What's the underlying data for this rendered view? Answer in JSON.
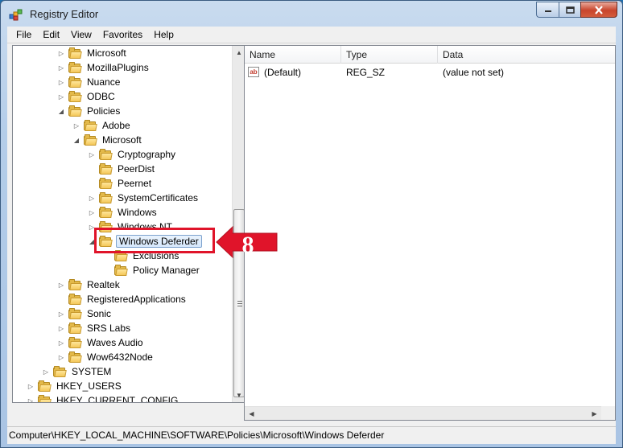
{
  "window": {
    "title": "Registry Editor",
    "controls": {
      "minimize": "minimize",
      "maximize": "maximize",
      "close": "close"
    }
  },
  "menu": [
    "File",
    "Edit",
    "View",
    "Favorites",
    "Help"
  ],
  "tree": [
    {
      "label": "Microsoft",
      "level": 2,
      "state": "collapsed"
    },
    {
      "label": "MozillaPlugins",
      "level": 2,
      "state": "collapsed"
    },
    {
      "label": "Nuance",
      "level": 2,
      "state": "collapsed"
    },
    {
      "label": "ODBC",
      "level": 2,
      "state": "collapsed"
    },
    {
      "label": "Policies",
      "level": 2,
      "state": "expanded"
    },
    {
      "label": "Adobe",
      "level": 3,
      "state": "collapsed"
    },
    {
      "label": "Microsoft",
      "level": 3,
      "state": "expanded"
    },
    {
      "label": "Cryptography",
      "level": 4,
      "state": "collapsed"
    },
    {
      "label": "PeerDist",
      "level": 4,
      "state": "none"
    },
    {
      "label": "Peernet",
      "level": 4,
      "state": "none"
    },
    {
      "label": "SystemCertificates",
      "level": 4,
      "state": "collapsed"
    },
    {
      "label": "Windows",
      "level": 4,
      "state": "collapsed"
    },
    {
      "label": "Windows NT",
      "level": 4,
      "state": "collapsed"
    },
    {
      "label": "Windows Deferder",
      "level": 4,
      "state": "expanded",
      "selected": true
    },
    {
      "label": "Exclusions",
      "level": 5,
      "state": "none"
    },
    {
      "label": "Policy Manager",
      "level": 5,
      "state": "none"
    },
    {
      "label": "Realtek",
      "level": 2,
      "state": "collapsed"
    },
    {
      "label": "RegisteredApplications",
      "level": 2,
      "state": "none"
    },
    {
      "label": "Sonic",
      "level": 2,
      "state": "collapsed"
    },
    {
      "label": "SRS Labs",
      "level": 2,
      "state": "collapsed"
    },
    {
      "label": "Waves Audio",
      "level": 2,
      "state": "collapsed"
    },
    {
      "label": "Wow6432Node",
      "level": 2,
      "state": "collapsed"
    },
    {
      "label": "SYSTEM",
      "level": 1,
      "state": "collapsed"
    },
    {
      "label": "HKEY_USERS",
      "level": 0,
      "state": "collapsed"
    },
    {
      "label": "HKEY_CURRENT_CONFIG",
      "level": 0,
      "state": "collapsed"
    }
  ],
  "list": {
    "columns": [
      "Name",
      "Type",
      "Data"
    ],
    "rows": [
      {
        "name": "(Default)",
        "type": "REG_SZ",
        "data": "(value not set)",
        "icon": "string-value-icon"
      }
    ]
  },
  "callout": {
    "number": "8",
    "color": "#e0142a"
  },
  "status": {
    "path": "Computer\\HKEY_LOCAL_MACHINE\\SOFTWARE\\Policies\\Microsoft\\Windows Deferder"
  },
  "colors": {
    "accent": "#e0142a",
    "selection": "#d5e7fb",
    "folder": "#f4c85a"
  },
  "icons": {
    "app": "registry-editor-icon",
    "folder": "folder-icon",
    "value": "string-value-icon"
  }
}
